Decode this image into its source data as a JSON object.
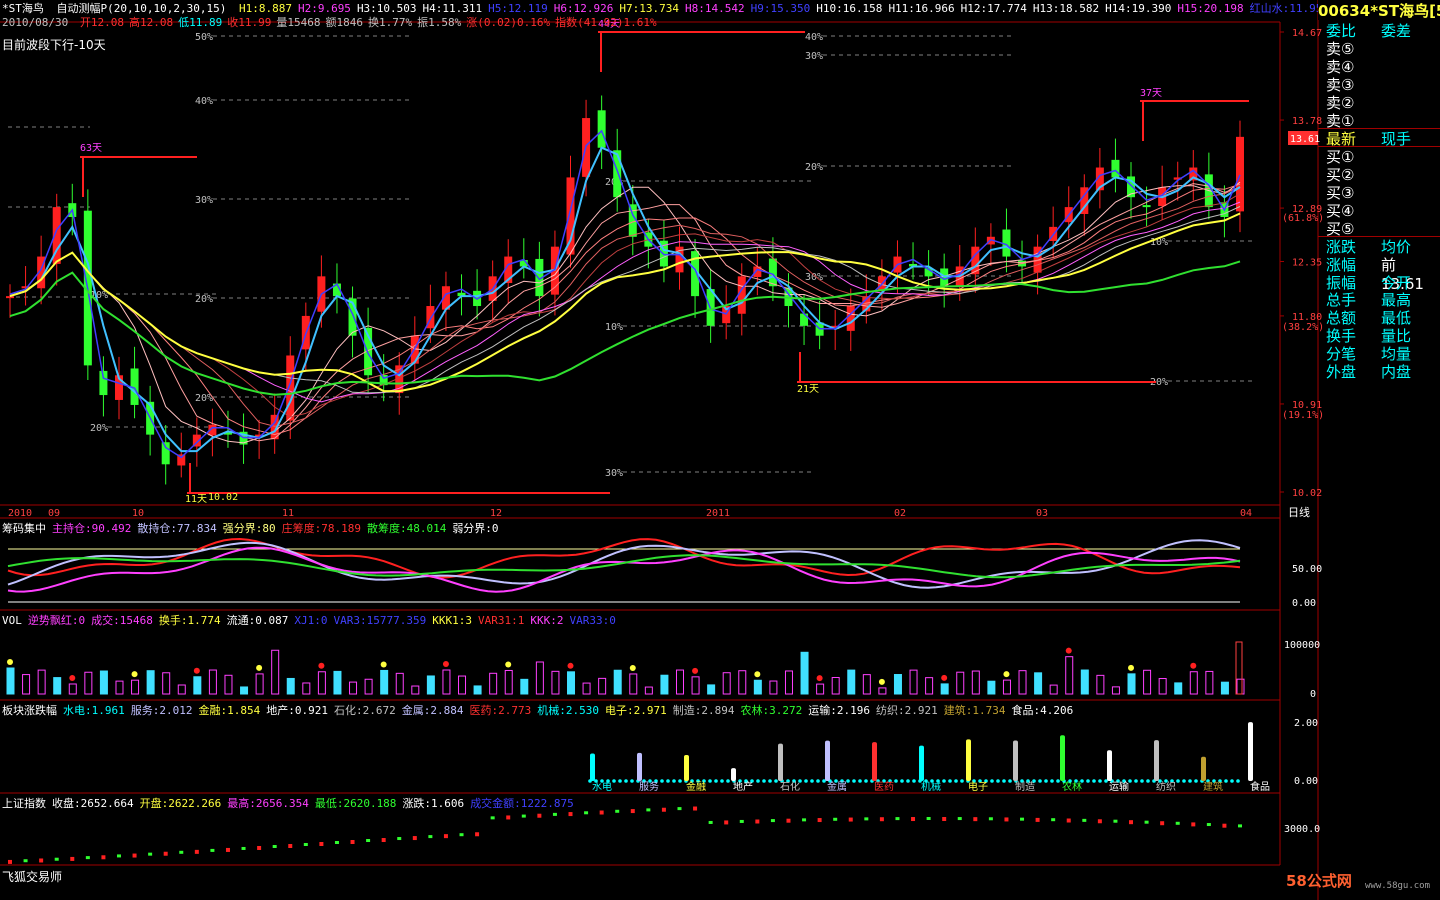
{
  "header": {
    "title": "*ST海鸟",
    "indicator": "自动测幅P",
    "params": "(20,10,10,2,30,15)",
    "h_values": [
      "H1:8.887",
      "H2:9.695",
      "H3:10.503",
      "H4:11.311",
      "H5:12.119",
      "H6:12.926",
      "H7:13.734",
      "H8:14.542",
      "H9:15.350",
      "H10:16.158",
      "H11:16.966",
      "H12:17.774",
      "H13:18.582",
      "H14:19.390",
      "H15:20.198"
    ],
    "extra": [
      "红山水:11.950",
      "绿山水"
    ]
  },
  "quote_line": {
    "date": "2010/08/30",
    "items": [
      {
        "label": "开",
        "value": "12.08",
        "color": "#ff3030"
      },
      {
        "label": "高",
        "value": "12.08",
        "color": "#ff3030"
      },
      {
        "label": "低",
        "value": "11.89",
        "color": "#00ffff"
      },
      {
        "label": "收",
        "value": "11.99",
        "color": "#ff3030"
      },
      {
        "label": "量",
        "value": "15468",
        "color": "#c0c0c0"
      },
      {
        "label": "额",
        "value": "1846",
        "color": "#c0c0c0"
      },
      {
        "label": "换",
        "value": "1.77%",
        "color": "#c0c0c0"
      },
      {
        "label": "振",
        "value": "1.58%",
        "color": "#c0c0c0"
      },
      {
        "label": "涨",
        "value": "(0.02)0.16%",
        "color": "#ff3030"
      },
      {
        "label": "指数",
        "value": "(41.92)1.61%",
        "color": "#ff3030"
      }
    ]
  },
  "main_panel": {
    "trend_label": "目前波段下行-10天",
    "peak_labels": [
      {
        "id": "p63",
        "text": "63天",
        "color": "#ff40ff"
      },
      {
        "id": "p44",
        "text": "44天",
        "color": "#ff40ff"
      },
      {
        "id": "p37",
        "text": "37天",
        "color": "#ff40ff"
      },
      {
        "id": "p21",
        "text": "21天",
        "color": "#ffff40"
      },
      {
        "id": "p11",
        "text": "11天",
        "color": "#ffff40"
      }
    ],
    "low_price_label": "10.02",
    "pct_labels": [
      "50%",
      "40%",
      "30%",
      "20%",
      "10%",
      "20%",
      "40%",
      "30%",
      "20%",
      "10%",
      "20%",
      "30%",
      "10%",
      "20%",
      "20%",
      "30%"
    ],
    "price_axis": [
      "14.67",
      "13.78",
      "12.89",
      "12.35",
      "11.80",
      "10.91",
      "10.02"
    ],
    "price_pct": [
      "(61.8%)",
      "(38.2%)",
      "(19.1%)"
    ],
    "current_price_tag": "13.61",
    "date_axis": [
      "2010",
      "09",
      "10",
      "11",
      "12",
      "2011",
      "02",
      "03",
      "04"
    ],
    "period_label": "日线"
  },
  "chip_panel": {
    "title": "筹码集中",
    "items": [
      {
        "label": "主持仓:90.492",
        "color": "#ff40ff"
      },
      {
        "label": "散持仓:77.834",
        "color": "#c0c0ff"
      },
      {
        "label": "强分界:80",
        "color": "#ffff80"
      },
      {
        "label": "庄筹度:78.189",
        "color": "#ff3030"
      },
      {
        "label": "散筹度:48.014",
        "color": "#30ff30"
      },
      {
        "label": "弱分界:0",
        "color": "#ffffff"
      }
    ],
    "axis": [
      "50.00",
      "0.00"
    ]
  },
  "vol_panel": {
    "title": "VOL",
    "items": [
      {
        "label": "逆势飘红:0",
        "color": "#ff40ff"
      },
      {
        "label": "成交:15468",
        "color": "#ff40ff"
      },
      {
        "label": "换手:1.774",
        "color": "#ffff40"
      },
      {
        "label": "流通:0.087",
        "color": "#ffffff"
      },
      {
        "label": "XJ1:0",
        "color": "#4040ff"
      },
      {
        "label": "VAR3:15777.359",
        "color": "#4040ff"
      },
      {
        "label": "KKK1:3",
        "color": "#ffff40"
      },
      {
        "label": "VAR31:1",
        "color": "#ff3030"
      },
      {
        "label": "KKK:2",
        "color": "#ff40ff"
      },
      {
        "label": "VAR33:0",
        "color": "#4040ff"
      }
    ],
    "axis": [
      "100000",
      "0"
    ]
  },
  "sector_panel": {
    "title": "板块涨跌幅",
    "items": [
      {
        "label": "水电:1.961",
        "color": "#00ffff"
      },
      {
        "label": "服务:2.012",
        "color": "#c0c0ff"
      },
      {
        "label": "金融:1.854",
        "color": "#ffff40"
      },
      {
        "label": "地产:0.921",
        "color": "#ffffff"
      },
      {
        "label": "石化:2.672",
        "color": "#c0c0c0"
      },
      {
        "label": "金属:2.884",
        "color": "#c0c0ff"
      },
      {
        "label": "医药:2.773",
        "color": "#ff3030"
      },
      {
        "label": "机械:2.530",
        "color": "#00ffff"
      },
      {
        "label": "电子:2.971",
        "color": "#ffff40"
      },
      {
        "label": "制造:2.894",
        "color": "#c0c0c0"
      },
      {
        "label": "农林:3.272",
        "color": "#30ff30"
      },
      {
        "label": "运输:2.196",
        "color": "#ffffff"
      },
      {
        "label": "纺织:2.921",
        "color": "#c0c0c0"
      },
      {
        "label": "建筑:1.734",
        "color": "#c0a030"
      },
      {
        "label": "食品:4.206",
        "color": "#ffffff"
      }
    ],
    "axis": [
      "2.00",
      "0.00"
    ]
  },
  "index_panel": {
    "title": "上证指数",
    "items": [
      {
        "label": "收盘:2652.664",
        "color": "#ffffff"
      },
      {
        "label": "开盘:2622.266",
        "color": "#ffff40"
      },
      {
        "label": "最高:2656.354",
        "color": "#ff40ff"
      },
      {
        "label": "最低:2620.188",
        "color": "#30ff30"
      },
      {
        "label": "涨跌:1.606",
        "color": "#ffffff"
      },
      {
        "label": "成交金额:1222.875",
        "color": "#4040ff"
      }
    ],
    "axis": [
      "3000.0"
    ],
    "footer": "飞狐交易师"
  },
  "right_panel": {
    "code": "00634",
    "name": "*ST海鸟",
    "suffix": "[54",
    "rows": [
      {
        "l": "委比",
        "r": "委差",
        "lc": "#00ffff",
        "rc": "#00ffff"
      },
      {
        "l": "卖⑤",
        "r": "",
        "lc": "#ffffff",
        "rc": "#ffffff"
      },
      {
        "l": "卖④",
        "r": "",
        "lc": "#ffffff",
        "rc": "#ffffff"
      },
      {
        "l": "卖③",
        "r": "",
        "lc": "#ffffff",
        "rc": "#ffffff"
      },
      {
        "l": "卖②",
        "r": "",
        "lc": "#ffffff",
        "rc": "#ffffff"
      },
      {
        "l": "卖①",
        "r": "",
        "lc": "#ffffff",
        "rc": "#ffffff"
      },
      {
        "l": "最新",
        "r": "现手",
        "lc": "#ffff40",
        "rc": "#00ffff"
      },
      {
        "l": "买①",
        "r": "",
        "lc": "#ffffff",
        "rc": "#ffffff"
      },
      {
        "l": "买②",
        "r": "",
        "lc": "#ffffff",
        "rc": "#ffffff"
      },
      {
        "l": "买③",
        "r": "",
        "lc": "#ffffff",
        "rc": "#ffffff"
      },
      {
        "l": "买④",
        "r": "",
        "lc": "#ffffff",
        "rc": "#ffffff"
      },
      {
        "l": "买⑤",
        "r": "",
        "lc": "#ffffff",
        "rc": "#ffffff"
      },
      {
        "l": "涨跌",
        "r": "均价",
        "lc": "#00ffff",
        "rc": "#00ffff"
      },
      {
        "l": "涨幅",
        "r": "前 13.61",
        "lc": "#00ffff",
        "rc": "#ffffff"
      },
      {
        "l": "振幅",
        "r": "今开",
        "lc": "#00ffff",
        "rc": "#00ffff"
      },
      {
        "l": "总手",
        "r": "最高",
        "lc": "#00ffff",
        "rc": "#00ffff"
      },
      {
        "l": "总额",
        "r": "最低",
        "lc": "#00ffff",
        "rc": "#00ffff"
      },
      {
        "l": "换手",
        "r": "量比",
        "lc": "#00ffff",
        "rc": "#00ffff"
      },
      {
        "l": "分笔",
        "r": "均量",
        "lc": "#00ffff",
        "rc": "#00ffff"
      },
      {
        "l": "外盘",
        "r": "内盘",
        "lc": "#00ffff",
        "rc": "#00ffff"
      }
    ]
  },
  "watermark": {
    "brand": "58公式网",
    "url": "www.58gu.com"
  },
  "chart_data": {
    "type": "candlestick",
    "title": "*ST海鸟 日线",
    "date_range": [
      "2010-08-30",
      "2011-04"
    ],
    "ylim": [
      10.02,
      14.67
    ],
    "price_ticks": [
      10.02,
      10.91,
      11.8,
      12.35,
      12.89,
      13.78,
      14.67
    ],
    "close_series_approx": [
      12.0,
      12.1,
      12.4,
      12.9,
      12.8,
      11.3,
      11.0,
      11.2,
      10.9,
      10.6,
      10.3,
      10.4,
      10.6,
      10.7,
      10.6,
      10.5,
      10.6,
      10.8,
      11.4,
      11.8,
      12.2,
      12.0,
      11.6,
      11.2,
      11.1,
      11.3,
      11.6,
      11.9,
      12.1,
      12.0,
      11.9,
      12.2,
      12.4,
      12.3,
      12.0,
      12.5,
      13.2,
      13.8,
      13.5,
      13.0,
      12.6,
      12.5,
      12.3,
      12.5,
      12.0,
      11.7,
      11.9,
      12.2,
      12.3,
      12.1,
      11.9,
      11.7,
      11.6,
      11.7,
      11.9,
      12.0,
      12.2,
      12.4,
      12.3,
      12.2,
      12.1,
      12.3,
      12.5,
      12.6,
      12.4,
      12.3,
      12.5,
      12.7,
      12.9,
      13.1,
      13.3,
      13.2,
      13.0,
      12.9,
      13.1,
      13.2,
      13.3,
      12.9,
      12.8,
      13.61
    ],
    "volume_max": 100000,
    "last_volume": 15468
  }
}
